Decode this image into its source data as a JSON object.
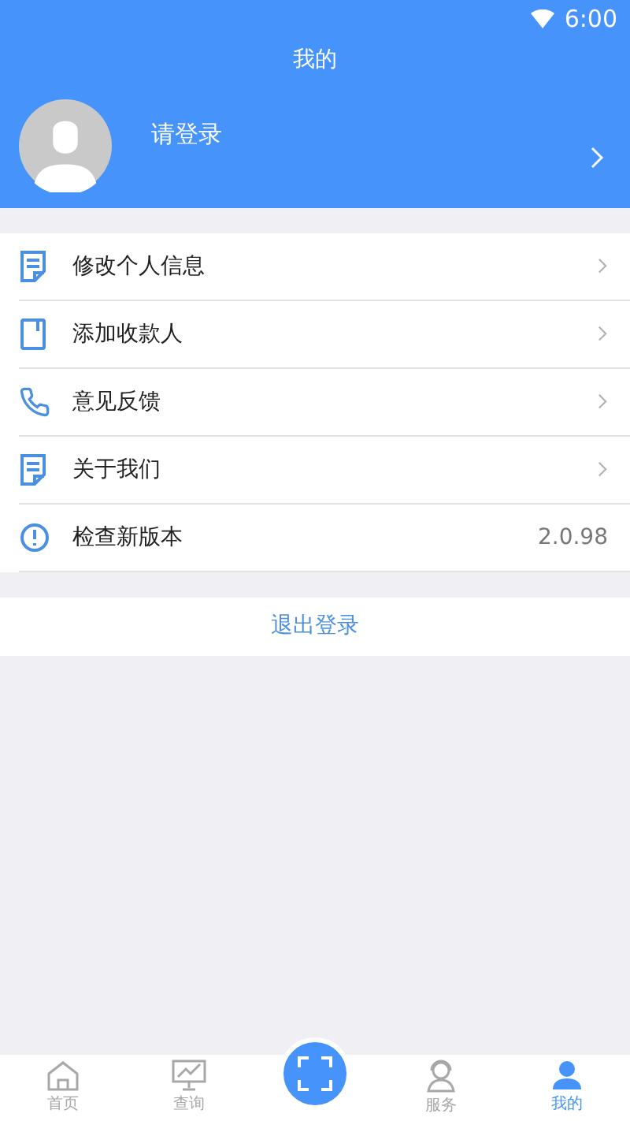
{
  "status_bar": {
    "time": "6:00"
  },
  "title": "我的",
  "profile": {
    "login_prompt": "请登录"
  },
  "menu": [
    {
      "kind": "link",
      "label": "修改个人信息"
    },
    {
      "kind": "link",
      "label": "添加收款人"
    },
    {
      "kind": "link",
      "label": "意见反馈"
    },
    {
      "kind": "link",
      "label": "关于我们"
    },
    {
      "kind": "value",
      "label": "检查新版本",
      "value": "2.0.98"
    }
  ],
  "logout": "退出登录",
  "tabs": [
    {
      "label": "首页",
      "selected": false
    },
    {
      "label": "查询",
      "selected": false
    },
    {
      "kind": "scan"
    },
    {
      "label": "服务",
      "selected": false
    },
    {
      "label": "我的",
      "selected": true
    }
  ]
}
